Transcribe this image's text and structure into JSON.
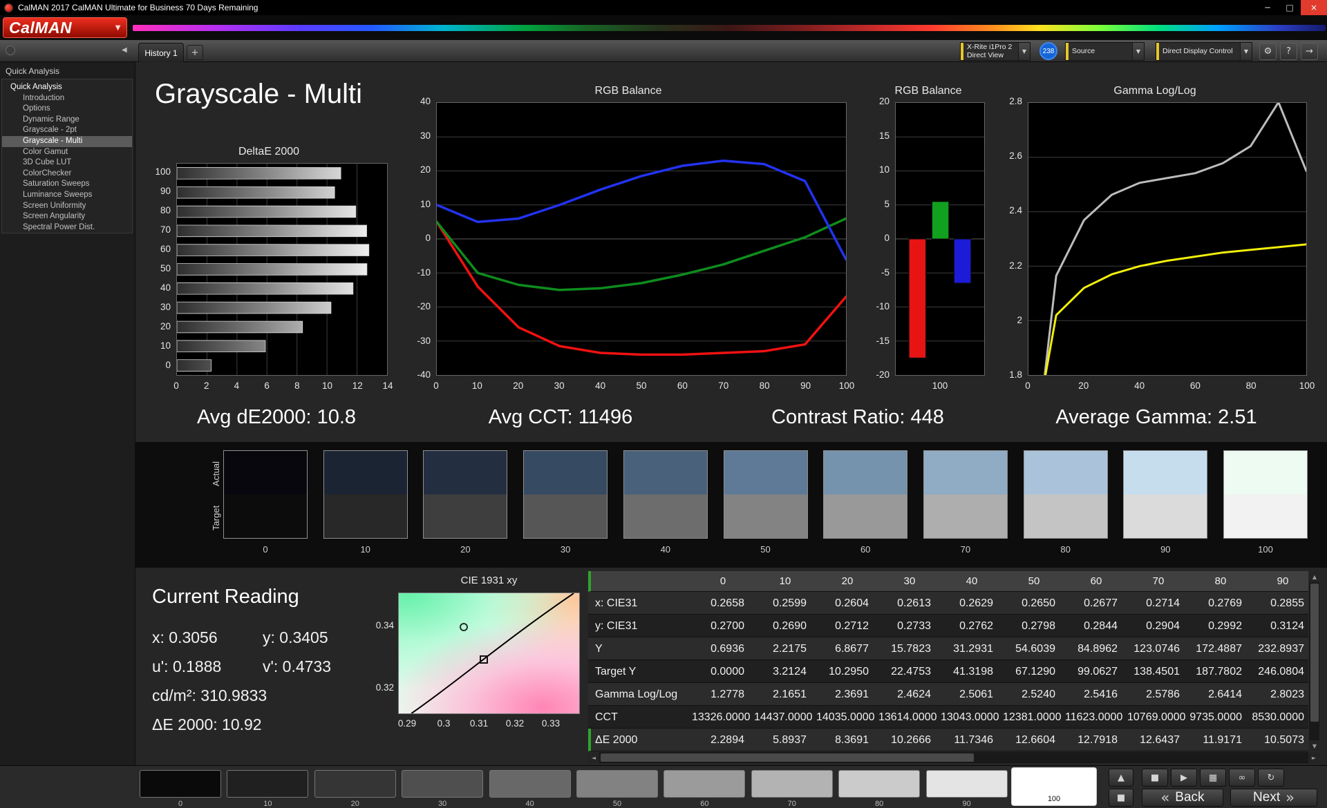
{
  "window": {
    "title": "CalMAN 2017 CalMAN Ultimate for Business 70 Days Remaining"
  },
  "icons": {
    "caret_down": "▼",
    "collapse_left": "◀",
    "window_min": "─",
    "window_max": "□",
    "window_close": "×",
    "gear": "⚙",
    "help": "?",
    "expand": "→",
    "scroll_left": "◄",
    "scroll_right": "►",
    "scroll_up": "▲",
    "scroll_down": "▼",
    "plus": "+"
  },
  "brand": {
    "logo": "CalMAN"
  },
  "tabs": {
    "active": "History 1"
  },
  "toolbar": {
    "meter": {
      "line1": "X-Rite i1Pro 2",
      "line2": "Direct View"
    },
    "badge": "238",
    "source": "Source",
    "display_control": "Direct Display Control"
  },
  "sidebar": {
    "section": "Quick Analysis",
    "root": "Quick Analysis",
    "items": [
      {
        "label": "Introduction",
        "selected": false
      },
      {
        "label": "Options",
        "selected": false
      },
      {
        "label": "Dynamic Range",
        "selected": false
      },
      {
        "label": "Grayscale - 2pt",
        "selected": false
      },
      {
        "label": "Grayscale - Multi",
        "selected": true
      },
      {
        "label": "Color Gamut",
        "selected": false
      },
      {
        "label": "3D Cube LUT",
        "selected": false
      },
      {
        "label": "ColorChecker",
        "selected": false
      },
      {
        "label": "Saturation Sweeps",
        "selected": false
      },
      {
        "label": "Luminance Sweeps",
        "selected": false
      },
      {
        "label": "Screen Uniformity",
        "selected": false
      },
      {
        "label": "Screen Angularity",
        "selected": false
      },
      {
        "label": "Spectral Power Dist.",
        "selected": false
      }
    ]
  },
  "page": {
    "title": "Grayscale - Multi"
  },
  "summary": [
    "Avg dE2000: 10.8",
    "Avg CCT: 11496",
    "Contrast Ratio: 448",
    "Average Gamma: 2.51"
  ],
  "chart_data": [
    {
      "type": "bar",
      "orientation": "horizontal",
      "title": "DeltaE 2000",
      "categories": [
        "100",
        "90",
        "80",
        "70",
        "60",
        "50",
        "40",
        "30",
        "20",
        "10",
        "0"
      ],
      "values": [
        10.92,
        10.5073,
        11.9171,
        12.6437,
        12.7918,
        12.6604,
        11.7346,
        10.2666,
        8.3691,
        5.8937,
        2.2894
      ],
      "xlim": [
        0,
        14
      ],
      "xticks": [
        0,
        2,
        4,
        6,
        8,
        10,
        12,
        14
      ]
    },
    {
      "type": "line",
      "title": "RGB Balance",
      "x": [
        0,
        10,
        20,
        30,
        40,
        50,
        60,
        70,
        80,
        90,
        100
      ],
      "ylim": [
        -40,
        40
      ],
      "yticks": [
        40,
        30,
        20,
        10,
        0,
        -10,
        -20,
        -30,
        -40
      ],
      "xticks": [
        0,
        10,
        20,
        30,
        40,
        50,
        60,
        70,
        80,
        90,
        100
      ],
      "series": [
        {
          "name": "Red",
          "color": "#f01111",
          "values": [
            5,
            -14,
            -26,
            -31.5,
            -33.5,
            -34,
            -34,
            -33.5,
            -33,
            -31,
            -17
          ]
        },
        {
          "name": "Green",
          "color": "#0e8c1e",
          "values": [
            5,
            -10,
            -13.5,
            -15,
            -14.5,
            -13,
            -10.5,
            -7.5,
            -3.5,
            0.5,
            6
          ]
        },
        {
          "name": "Blue",
          "color": "#2233f0",
          "values": [
            10,
            5,
            6,
            10,
            14.5,
            18.5,
            21.5,
            23,
            22,
            17,
            -6
          ]
        }
      ]
    },
    {
      "type": "bar",
      "title": "RGB Balance",
      "categories": [
        "100"
      ],
      "ylim": [
        -20,
        20
      ],
      "ytic_step": 5,
      "yticks": [
        20,
        15,
        10,
        5,
        0,
        -5,
        -10,
        -15,
        -20
      ],
      "series": [
        {
          "name": "Red",
          "color": "#e81414",
          "value": -17.5
        },
        {
          "name": "Green",
          "color": "#12a11f",
          "value": 5.5
        },
        {
          "name": "Blue",
          "color": "#1b1bd8",
          "value": -6.5
        }
      ]
    },
    {
      "type": "line",
      "title": "Gamma Log/Log",
      "x": [
        0,
        10,
        20,
        30,
        40,
        50,
        60,
        70,
        80,
        90,
        100
      ],
      "ylim": [
        1.8,
        2.8
      ],
      "yticks": [
        2.8,
        2.6,
        2.4,
        2.2,
        2,
        1.8
      ],
      "xticks": [
        0,
        20,
        40,
        60,
        80,
        100
      ],
      "series": [
        {
          "name": "Measured Gamma",
          "color": "#bcbcbc",
          "values": [
            1.2778,
            2.1651,
            2.3691,
            2.4624,
            2.5061,
            2.524,
            2.5416,
            2.5786,
            2.6414,
            2.8023,
            2.55
          ]
        },
        {
          "name": "Target Gamma",
          "color": "#f2ef0c",
          "values": [
            1.45,
            2.02,
            2.12,
            2.17,
            2.2,
            2.22,
            2.235,
            2.25,
            2.26,
            2.27,
            2.28
          ]
        }
      ]
    }
  ],
  "swatches": {
    "row_labels": [
      "Actual",
      "Target"
    ],
    "columns": [
      {
        "label": "0",
        "actual": "#07070d",
        "target": "#0c0c0c"
      },
      {
        "label": "10",
        "actual": "#1b2433",
        "target": "#282828"
      },
      {
        "label": "20",
        "actual": "#232e41",
        "target": "#3e3e3e"
      },
      {
        "label": "30",
        "actual": "#364a61",
        "target": "#565656"
      },
      {
        "label": "40",
        "actual": "#4a617c",
        "target": "#6d6d6d"
      },
      {
        "label": "50",
        "actual": "#5e7a96",
        "target": "#838383"
      },
      {
        "label": "60",
        "actual": "#7693ae",
        "target": "#999999"
      },
      {
        "label": "70",
        "actual": "#90abc4",
        "target": "#aeaeae"
      },
      {
        "label": "80",
        "actual": "#aac3da",
        "target": "#c4c4c4"
      },
      {
        "label": "90",
        "actual": "#c6ddee",
        "target": "#dbdbdb"
      },
      {
        "label": "100",
        "actual": "#edfbf3",
        "target": "#f2f2f2"
      }
    ]
  },
  "current_reading": {
    "title": "Current Reading",
    "x": "x: 0.3056",
    "y": "y: 0.3405",
    "u": "u': 0.1888",
    "v": "v': 0.4733",
    "luminance": "cd/m²: 310.9833",
    "de": "ΔE 2000: 10.92"
  },
  "cie_chart": {
    "title": "CIE 1931 xy",
    "yticks": [
      "0.34",
      "0.32"
    ],
    "xticks": [
      "0.29",
      "0.3",
      "0.31",
      "0.32",
      "0.33"
    ]
  },
  "table": {
    "columns": [
      "0",
      "10",
      "20",
      "30",
      "40",
      "50",
      "60",
      "70",
      "80",
      "90"
    ],
    "rows": [
      {
        "label": "x: CIE31",
        "values": [
          "0.2658",
          "0.2599",
          "0.2604",
          "0.2613",
          "0.2629",
          "0.2650",
          "0.2677",
          "0.2714",
          "0.2769",
          "0.2855"
        ]
      },
      {
        "label": "y: CIE31",
        "values": [
          "0.2700",
          "0.2690",
          "0.2712",
          "0.2733",
          "0.2762",
          "0.2798",
          "0.2844",
          "0.2904",
          "0.2992",
          "0.3124"
        ]
      },
      {
        "label": "Y",
        "values": [
          "0.6936",
          "2.2175",
          "6.8677",
          "15.7823",
          "31.2931",
          "54.6039",
          "84.8962",
          "123.0746",
          "172.4887",
          "232.8937"
        ]
      },
      {
        "label": "Target Y",
        "values": [
          "0.0000",
          "3.2124",
          "10.2950",
          "22.4753",
          "41.3198",
          "67.1290",
          "99.0627",
          "138.4501",
          "187.7802",
          "246.0804"
        ]
      },
      {
        "label": "Gamma Log/Log",
        "values": [
          "1.2778",
          "2.1651",
          "2.3691",
          "2.4624",
          "2.5061",
          "2.5240",
          "2.5416",
          "2.5786",
          "2.6414",
          "2.8023"
        ]
      },
      {
        "label": "CCT",
        "values": [
          "13326.0000",
          "14437.0000",
          "14035.0000",
          "13614.0000",
          "13043.0000",
          "12381.0000",
          "11623.0000",
          "10769.0000",
          "9735.0000",
          "8530.0000"
        ]
      },
      {
        "label": "ΔE 2000",
        "values": [
          "2.2894",
          "5.8937",
          "8.3691",
          "10.2666",
          "11.7346",
          "12.6604",
          "12.7918",
          "12.6437",
          "11.9171",
          "10.5073"
        ]
      }
    ]
  },
  "patch_bar": [
    {
      "label": "0",
      "color": "#0a0a0a",
      "selected": false
    },
    {
      "label": "10",
      "color": "#202020",
      "selected": false
    },
    {
      "label": "20",
      "color": "#353535",
      "selected": false
    },
    {
      "label": "30",
      "color": "#4f4f4f",
      "selected": false
    },
    {
      "label": "40",
      "color": "#686868",
      "selected": false
    },
    {
      "label": "50",
      "color": "#828282",
      "selected": false
    },
    {
      "label": "60",
      "color": "#9b9b9b",
      "selected": false
    },
    {
      "label": "70",
      "color": "#b3b3b3",
      "selected": false
    },
    {
      "label": "80",
      "color": "#cbcbcb",
      "selected": false
    },
    {
      "label": "90",
      "color": "#e4e4e4",
      "selected": false
    },
    {
      "label": "100",
      "color": "#ffffff",
      "selected": true
    }
  ],
  "transport": {
    "back": "Back",
    "next": "Next",
    "back_chevron": "«",
    "next_chevron": "»",
    "buttons": [
      {
        "name": "eject",
        "glyph": "▲"
      },
      {
        "name": "pattern-window",
        "glyph": "■"
      },
      {
        "name": "stop",
        "glyph": "■"
      },
      {
        "name": "play",
        "glyph": "▶"
      },
      {
        "name": "pattern",
        "glyph": "▦"
      },
      {
        "name": "continuous",
        "glyph": "∞"
      },
      {
        "name": "refresh",
        "glyph": "↻"
      }
    ]
  },
  "accent_colors": {
    "selection_yellow": "#e6c62b",
    "table_accent_green": "#2ea52e",
    "badge_blue": "#1465d8",
    "logo_red": "#c00a0a"
  }
}
